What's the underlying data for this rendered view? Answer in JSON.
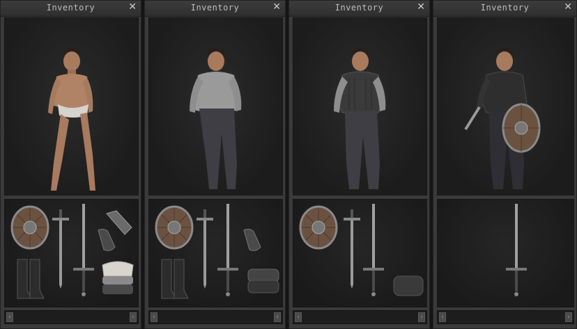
{
  "panels": [
    {
      "title": "Inventory",
      "close_glyph": "✕",
      "outfit": "underwear",
      "items": [
        "shield-icon",
        "sword-icon",
        "longsword-icon",
        "pants-icon",
        "gloves-icon",
        "boots-icon",
        "shirt-stack-icon"
      ]
    },
    {
      "title": "Inventory",
      "close_glyph": "✕",
      "outfit": "shirt-pants",
      "items": [
        "shield-icon",
        "sword-icon",
        "longsword-icon",
        "gloves-icon",
        "boots-icon",
        "shirt-icon"
      ]
    },
    {
      "title": "Inventory",
      "close_glyph": "✕",
      "outfit": "vest",
      "items": [
        "shield-icon",
        "sword-icon",
        "longsword-icon",
        "vest-icon"
      ]
    },
    {
      "title": "Inventory",
      "close_glyph": "✕",
      "outfit": "armed",
      "items": [
        "longsword-icon"
      ]
    }
  ],
  "scroll": {
    "left_glyph": "‹",
    "right_glyph": "›"
  }
}
